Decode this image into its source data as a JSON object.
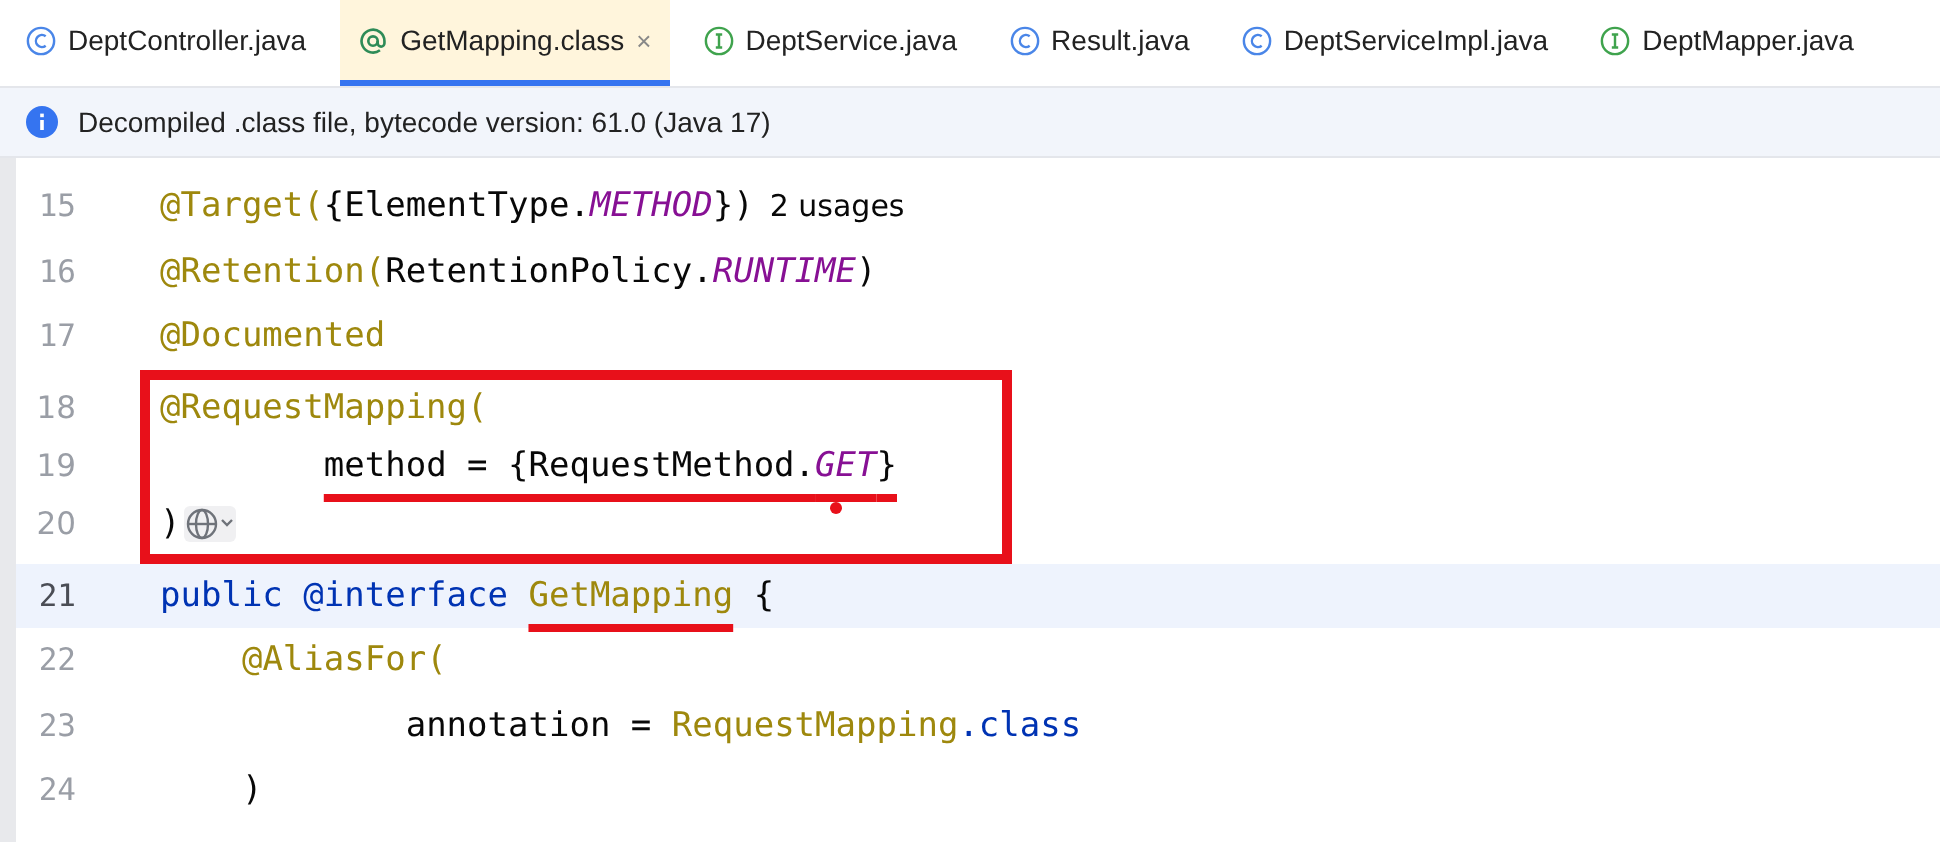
{
  "tabs": [
    {
      "label": "DeptController.java",
      "kind": "class",
      "selected": false
    },
    {
      "label": "GetMapping.class",
      "kind": "annotation",
      "selected": true,
      "close": "×"
    },
    {
      "label": "DeptService.java",
      "kind": "interface",
      "selected": false
    },
    {
      "label": "Result.java",
      "kind": "class",
      "selected": false
    },
    {
      "label": "DeptServiceImpl.java",
      "kind": "class",
      "selected": false
    },
    {
      "label": "DeptMapper.java",
      "kind": "interface",
      "selected": false
    }
  ],
  "banner": {
    "text": "Decompiled .class file, bytecode version: 61.0 (Java 17)"
  },
  "editor": {
    "lines": [
      {
        "number": "15",
        "boxed": false,
        "current": false,
        "tokens": [
          {
            "t": "@Target(",
            "kind": "ann"
          },
          {
            "t": "{ElementType.",
            "kind": "plain"
          },
          {
            "t": "METHOD",
            "kind": "const"
          },
          {
            "t": "})",
            "kind": "plain"
          },
          {
            "t": "2 usages",
            "kind": "hint"
          }
        ]
      },
      {
        "number": "16",
        "boxed": false,
        "current": false,
        "tokens": [
          {
            "t": "@Retention(",
            "kind": "ann"
          },
          {
            "t": "RetentionPolicy.",
            "kind": "plain"
          },
          {
            "t": "RUNTIME",
            "kind": "const"
          },
          {
            "t": ")",
            "kind": "plain"
          }
        ]
      },
      {
        "number": "17",
        "boxed": false,
        "current": false,
        "tokens": [
          {
            "t": "@Documented",
            "kind": "ann"
          }
        ]
      },
      {
        "number": "18",
        "boxed": true,
        "current": false,
        "tokens": [
          {
            "t": "@RequestMapping(",
            "kind": "ann"
          }
        ]
      },
      {
        "number": "19",
        "boxed": true,
        "current": false,
        "tokens": [
          {
            "t": "        method = {RequestMethod.",
            "kind": "plain",
            "underlined": true
          },
          {
            "t": "GET",
            "kind": "const",
            "underlined": true,
            "dot": true
          },
          {
            "t": "}",
            "kind": "plain",
            "underlined": true
          }
        ]
      },
      {
        "number": "20",
        "boxed": true,
        "current": false,
        "inlay_icon": true,
        "tokens": [
          {
            "t": ")",
            "kind": "plain"
          }
        ]
      },
      {
        "number": "21",
        "boxed": false,
        "current": true,
        "tokens": [
          {
            "t": "public @interface ",
            "kind": "kw"
          },
          {
            "t": "GetMapping",
            "kind": "ann",
            "underlined": true
          },
          {
            "t": " {",
            "kind": "plain"
          }
        ]
      },
      {
        "number": "22",
        "boxed": false,
        "current": false,
        "tokens": [
          {
            "t": "    @AliasFor(",
            "kind": "ann"
          }
        ]
      },
      {
        "number": "23",
        "boxed": false,
        "current": false,
        "tokens": [
          {
            "t": "            annotation = ",
            "kind": "plain"
          },
          {
            "t": "RequestMapping",
            "kind": "ann"
          },
          {
            "t": ".class",
            "kind": "kw"
          }
        ]
      },
      {
        "number": "24",
        "boxed": false,
        "current": false,
        "tokens": [
          {
            "t": "    )",
            "kind": "plain"
          }
        ]
      }
    ]
  }
}
